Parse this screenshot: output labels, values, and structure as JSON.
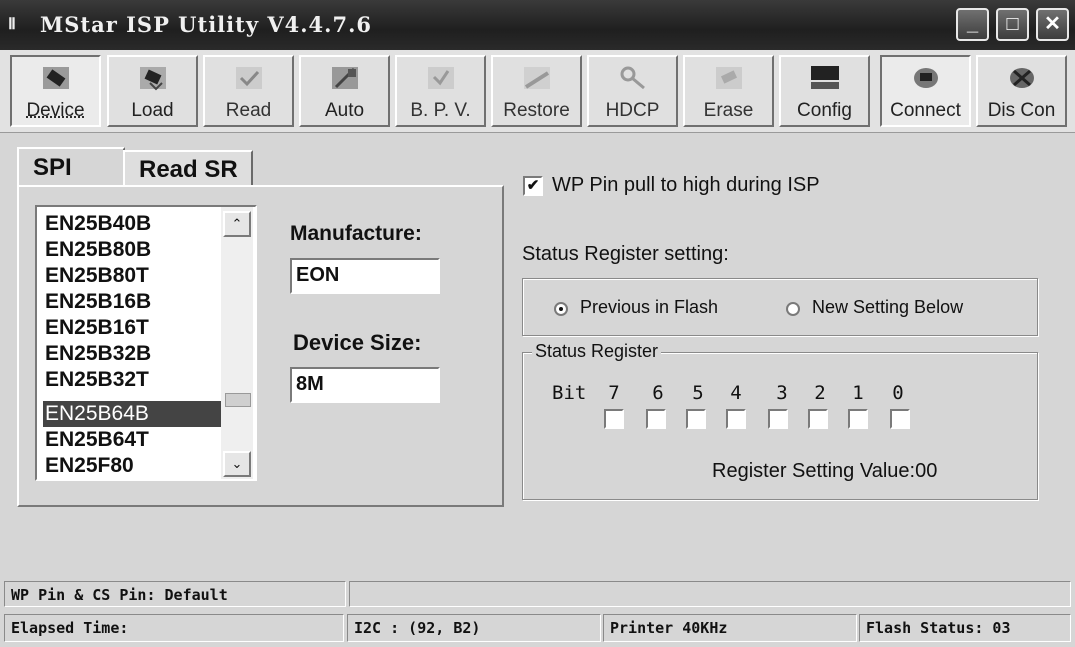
{
  "window": {
    "icon_glyph": "Ⅱ",
    "title": "MStar ISP Utility V4.4.7.6",
    "controls": [
      "_",
      "□",
      "✕"
    ]
  },
  "toolbar": {
    "buttons": [
      {
        "label": "Device",
        "icon": "device-chip-icon"
      },
      {
        "label": "Load",
        "icon": "load-icon"
      },
      {
        "label": "Read",
        "icon": "read-icon"
      },
      {
        "label": "Auto",
        "icon": "auto-icon"
      },
      {
        "label": "B. P. V.",
        "icon": "bpv-icon"
      },
      {
        "label": "Restore",
        "icon": "restore-icon"
      },
      {
        "label": "HDCP",
        "icon": "hdcp-key-icon"
      },
      {
        "label": "Erase",
        "icon": "erase-icon"
      },
      {
        "label": "Config",
        "icon": "config-icon"
      },
      {
        "label": "Connect",
        "icon": "connect-icon"
      },
      {
        "label": "Dis Con",
        "icon": "disconnect-icon"
      }
    ]
  },
  "tabs": [
    "SPI",
    "Read SR"
  ],
  "device_list": {
    "items": [
      "EN25B40B",
      "EN25B80B",
      "EN25B80T",
      "EN25B16B",
      "EN25B16T",
      "EN25B32B",
      "EN25B32T",
      "EN25B64B",
      "EN25B64T",
      "EN25F80"
    ],
    "selected": "EN25B64B",
    "scroll_up": "⌃",
    "scroll_down": "⌄"
  },
  "manufacture": {
    "label": "Manufacture:",
    "value": "EON"
  },
  "device_size": {
    "label": "Device Size:",
    "value": "8M"
  },
  "wp_pin": {
    "label": "WP Pin pull to high during ISP",
    "checked": true,
    "check_glyph": "✔"
  },
  "status_setting": {
    "label": "Status Register setting:",
    "options": [
      "Previous in Flash",
      "New Setting Below"
    ],
    "selected": "Previous in Flash"
  },
  "status_register": {
    "title": "Status Register",
    "bit_label": "Bit",
    "bits": [
      "7",
      "6",
      "5",
      "4",
      "3",
      "2",
      "1",
      "0"
    ],
    "value_text": "Register Setting Value:00"
  },
  "statusbar": {
    "wp_cs": "WP Pin & CS Pin: Default",
    "elapsed": "Elapsed Time:",
    "i2c": "I2C :  (92, B2)",
    "printer": "Printer  40KHz",
    "flash_status": "Flash Status: 03"
  },
  "colors": {
    "titlebar": "#262626",
    "selection": "#444444",
    "face": "#d6d6d6"
  }
}
